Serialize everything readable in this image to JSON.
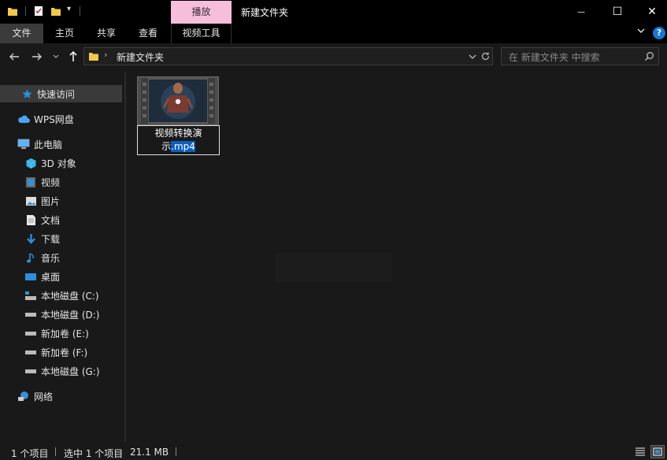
{
  "titlebar": {
    "context_tab": "播放",
    "window_title": "新建文件夹",
    "minimize_glyph": "—",
    "maximize_glyph": "☐",
    "close_glyph": "✕"
  },
  "ribbon": {
    "tabs": [
      {
        "label": "文件"
      },
      {
        "label": "主页"
      },
      {
        "label": "共享"
      },
      {
        "label": "查看"
      },
      {
        "label": "视频工具"
      }
    ],
    "help_glyph": "?"
  },
  "address": {
    "path": "新建文件夹",
    "search_placeholder": "在 新建文件夹 中搜索"
  },
  "sidebar": {
    "quick_access": "快速访问",
    "wps": "WPS网盘",
    "this_pc": "此电脑",
    "items": [
      {
        "label": "3D 对象",
        "icon": "3d-objects-icon"
      },
      {
        "label": "视频",
        "icon": "videos-icon"
      },
      {
        "label": "图片",
        "icon": "pictures-icon"
      },
      {
        "label": "文档",
        "icon": "documents-icon"
      },
      {
        "label": "下载",
        "icon": "downloads-icon"
      },
      {
        "label": "音乐",
        "icon": "music-icon"
      },
      {
        "label": "桌面",
        "icon": "desktop-icon"
      },
      {
        "label": "本地磁盘 (C:)",
        "icon": "system-drive-icon"
      },
      {
        "label": "本地磁盘 (D:)",
        "icon": "drive-icon"
      },
      {
        "label": "新加卷 (E:)",
        "icon": "drive-icon"
      },
      {
        "label": "新加卷 (F:)",
        "icon": "drive-icon"
      },
      {
        "label": "本地磁盘 (G:)",
        "icon": "drive-icon"
      }
    ],
    "network": "网络"
  },
  "file": {
    "name_part1": "视频转换演",
    "name_part2": "示",
    "name_ext": ".mp4"
  },
  "status": {
    "count": "1 个项目",
    "selection": "选中 1 个项目",
    "size": "21.1 MB"
  }
}
